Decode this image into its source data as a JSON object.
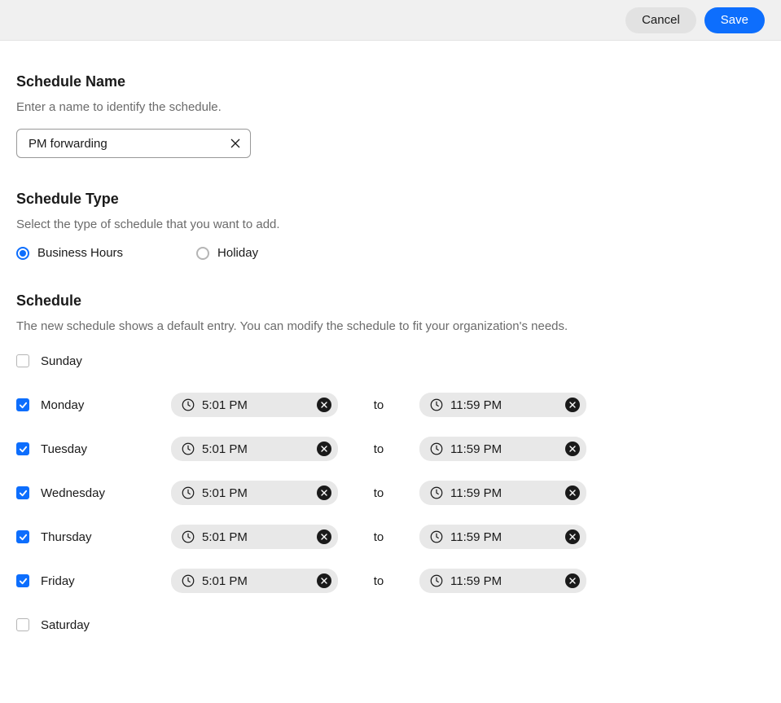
{
  "header": {
    "cancel_label": "Cancel",
    "save_label": "Save"
  },
  "schedule_name": {
    "title": "Schedule Name",
    "desc": "Enter a name to identify the schedule.",
    "value": "PM forwarding"
  },
  "schedule_type": {
    "title": "Schedule Type",
    "desc": "Select the type of schedule that you want to add.",
    "options": [
      {
        "label": "Business Hours",
        "selected": true
      },
      {
        "label": "Holiday",
        "selected": false
      }
    ]
  },
  "schedule": {
    "title": "Schedule",
    "desc": "The new schedule shows a default entry. You can modify the schedule to fit your organization's needs.",
    "to_label": "to",
    "days": [
      {
        "label": "Sunday",
        "checked": false,
        "start": "",
        "end": ""
      },
      {
        "label": "Monday",
        "checked": true,
        "start": "5:01 PM",
        "end": "11:59 PM"
      },
      {
        "label": "Tuesday",
        "checked": true,
        "start": "5:01 PM",
        "end": "11:59 PM"
      },
      {
        "label": "Wednesday",
        "checked": true,
        "start": "5:01 PM",
        "end": "11:59 PM"
      },
      {
        "label": "Thursday",
        "checked": true,
        "start": "5:01 PM",
        "end": "11:59 PM"
      },
      {
        "label": "Friday",
        "checked": true,
        "start": "5:01 PM",
        "end": "11:59 PM"
      },
      {
        "label": "Saturday",
        "checked": false,
        "start": "",
        "end": ""
      }
    ]
  }
}
